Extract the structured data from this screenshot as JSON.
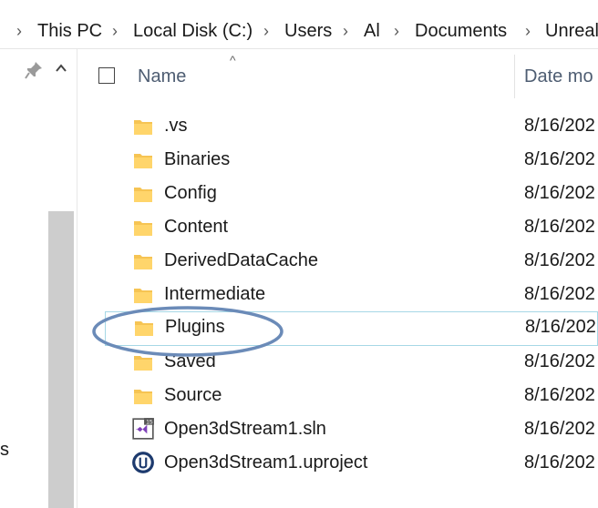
{
  "breadcrumb": [
    "This PC",
    "Local Disk (C:)",
    "Users",
    "Al",
    "Documents",
    "Unreal"
  ],
  "nav": {
    "fragment": "s"
  },
  "header": {
    "name_label": "Name",
    "date_label": "Date mo",
    "sort_indicator": "^"
  },
  "files": [
    {
      "name": ".vs",
      "date": "8/16/202",
      "type": "folder"
    },
    {
      "name": "Binaries",
      "date": "8/16/202",
      "type": "folder"
    },
    {
      "name": "Config",
      "date": "8/16/202",
      "type": "folder"
    },
    {
      "name": "Content",
      "date": "8/16/202",
      "type": "folder"
    },
    {
      "name": "DerivedDataCache",
      "date": "8/16/202",
      "type": "folder"
    },
    {
      "name": "Intermediate",
      "date": "8/16/202",
      "type": "folder"
    },
    {
      "name": "Plugins",
      "date": "8/16/202",
      "type": "folder",
      "hovered": true,
      "circled": true
    },
    {
      "name": "Saved",
      "date": "8/16/202",
      "type": "folder"
    },
    {
      "name": "Source",
      "date": "8/16/202",
      "type": "folder"
    },
    {
      "name": "Open3dStream1.sln",
      "date": "8/16/202",
      "type": "visual-studio-solution"
    },
    {
      "name": "Open3dStream1.uproject",
      "date": "8/16/202",
      "type": "unreal-project"
    }
  ],
  "colors": {
    "folder": "#f6c453",
    "hover_border": "#a6d8e6",
    "annotation_ring": "#6b8bb8",
    "header_text": "#4e5d72"
  }
}
